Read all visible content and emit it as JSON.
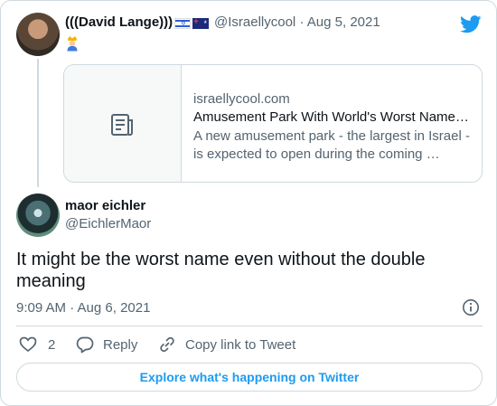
{
  "parent_tweet": {
    "display_name": "(((David Lange)))",
    "handle": "@Israellycool",
    "separator": "·",
    "date": "Aug 5, 2021",
    "flags": [
      "israel-flag",
      "australia-flag"
    ],
    "emoji": "person-with-crown-emoji",
    "link_card": {
      "domain": "israellycool.com",
      "title": "Amusement Park With World's Worst Name…",
      "description": "A new amusement park - the largest in Israel - is expected to open during the coming …",
      "thumbnail_icon": "article-icon"
    }
  },
  "reply_tweet": {
    "display_name": "maor eichler",
    "handle": "@EichlerMaor",
    "text": "It might be the worst name even without the double meaning",
    "time": "9:09 AM · Aug 6, 2021"
  },
  "actions": {
    "like_count": "2",
    "reply_label": "Reply",
    "copy_label": "Copy link to Tweet"
  },
  "explore_label": "Explore what's happening on Twitter",
  "colors": {
    "accent": "#1d9bf0",
    "secondary_text": "#536471",
    "border": "#cfd9de"
  },
  "icons": [
    "twitter-bird-icon",
    "info-icon",
    "heart-icon",
    "reply-icon",
    "link-icon",
    "article-icon"
  ]
}
